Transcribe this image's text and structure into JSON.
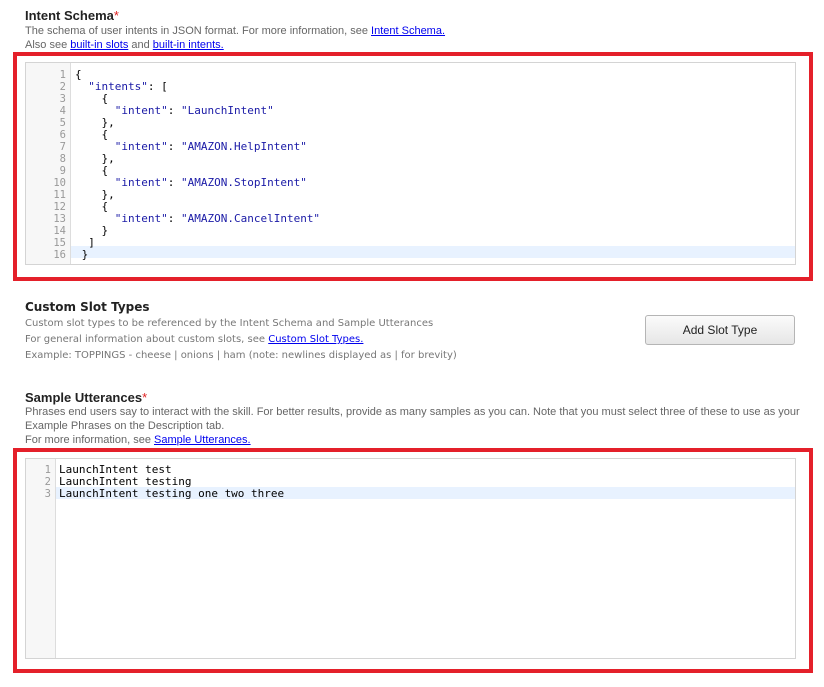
{
  "intent_schema": {
    "title": "Intent Schema",
    "required_mark": "*",
    "help_line1_prefix": "The schema of user intents in JSON format. For more information, see ",
    "help_line1_link": "Intent Schema.",
    "help_line2_prefix": "Also see ",
    "help_line2_link1": "built-in slots",
    "help_line2_mid": " and ",
    "help_line2_link2": "built-in intents.",
    "code_lines": [
      {
        "num": "1",
        "pre": "{",
        "str": "",
        "post": ""
      },
      {
        "num": "2",
        "pre": "  ",
        "str": "\"intents\"",
        "post": ": ["
      },
      {
        "num": "3",
        "pre": "    {",
        "str": "",
        "post": ""
      },
      {
        "num": "4",
        "pre": "      ",
        "str": "\"intent\"",
        "post": ": ",
        "str2": "\"LaunchIntent\""
      },
      {
        "num": "5",
        "pre": "    },",
        "str": "",
        "post": ""
      },
      {
        "num": "6",
        "pre": "    {",
        "str": "",
        "post": ""
      },
      {
        "num": "7",
        "pre": "      ",
        "str": "\"intent\"",
        "post": ": ",
        "str2": "\"AMAZON.HelpIntent\""
      },
      {
        "num": "8",
        "pre": "    },",
        "str": "",
        "post": ""
      },
      {
        "num": "9",
        "pre": "    {",
        "str": "",
        "post": ""
      },
      {
        "num": "10",
        "pre": "      ",
        "str": "\"intent\"",
        "post": ": ",
        "str2": "\"AMAZON.StopIntent\""
      },
      {
        "num": "11",
        "pre": "    },",
        "str": "",
        "post": ""
      },
      {
        "num": "12",
        "pre": "    {",
        "str": "",
        "post": ""
      },
      {
        "num": "13",
        "pre": "      ",
        "str": "\"intent\"",
        "post": ": ",
        "str2": "\"AMAZON.CancelIntent\""
      },
      {
        "num": "14",
        "pre": "    }",
        "str": "",
        "post": ""
      },
      {
        "num": "15",
        "pre": "  ]",
        "str": "",
        "post": ""
      },
      {
        "num": "16",
        "pre": " }",
        "str": "",
        "post": ""
      }
    ]
  },
  "custom_slot_types": {
    "title": "Custom Slot Types",
    "help_line1": "Custom slot types to be referenced by the Intent Schema and Sample Utterances",
    "help_line2_prefix": "For general information about custom slots, see ",
    "help_line2_link": "Custom Slot Types.",
    "help_line3": "Example: TOPPINGS - cheese | onions | ham (note: newlines displayed as | for brevity)",
    "add_button_label": "Add Slot Type"
  },
  "sample_utterances": {
    "title": "Sample Utterances",
    "required_mark": "*",
    "help_line1": "Phrases end users say to interact with the skill. For better results, provide as many samples as you can. Note that you must select three of these to use as your",
    "help_line2": "Example Phrases on the Description tab.",
    "help_line3_prefix": "For more information, see ",
    "help_line3_link": "Sample Utterances.",
    "lines": [
      {
        "num": "1",
        "text": "LaunchIntent test"
      },
      {
        "num": "2",
        "text": "LaunchIntent testing"
      },
      {
        "num": "3",
        "text": "LaunchIntent testing one two three"
      }
    ]
  },
  "colors": {
    "highlight_border": "#e4202a",
    "link": "#0000ee",
    "json_string": "#1a1aa6"
  }
}
